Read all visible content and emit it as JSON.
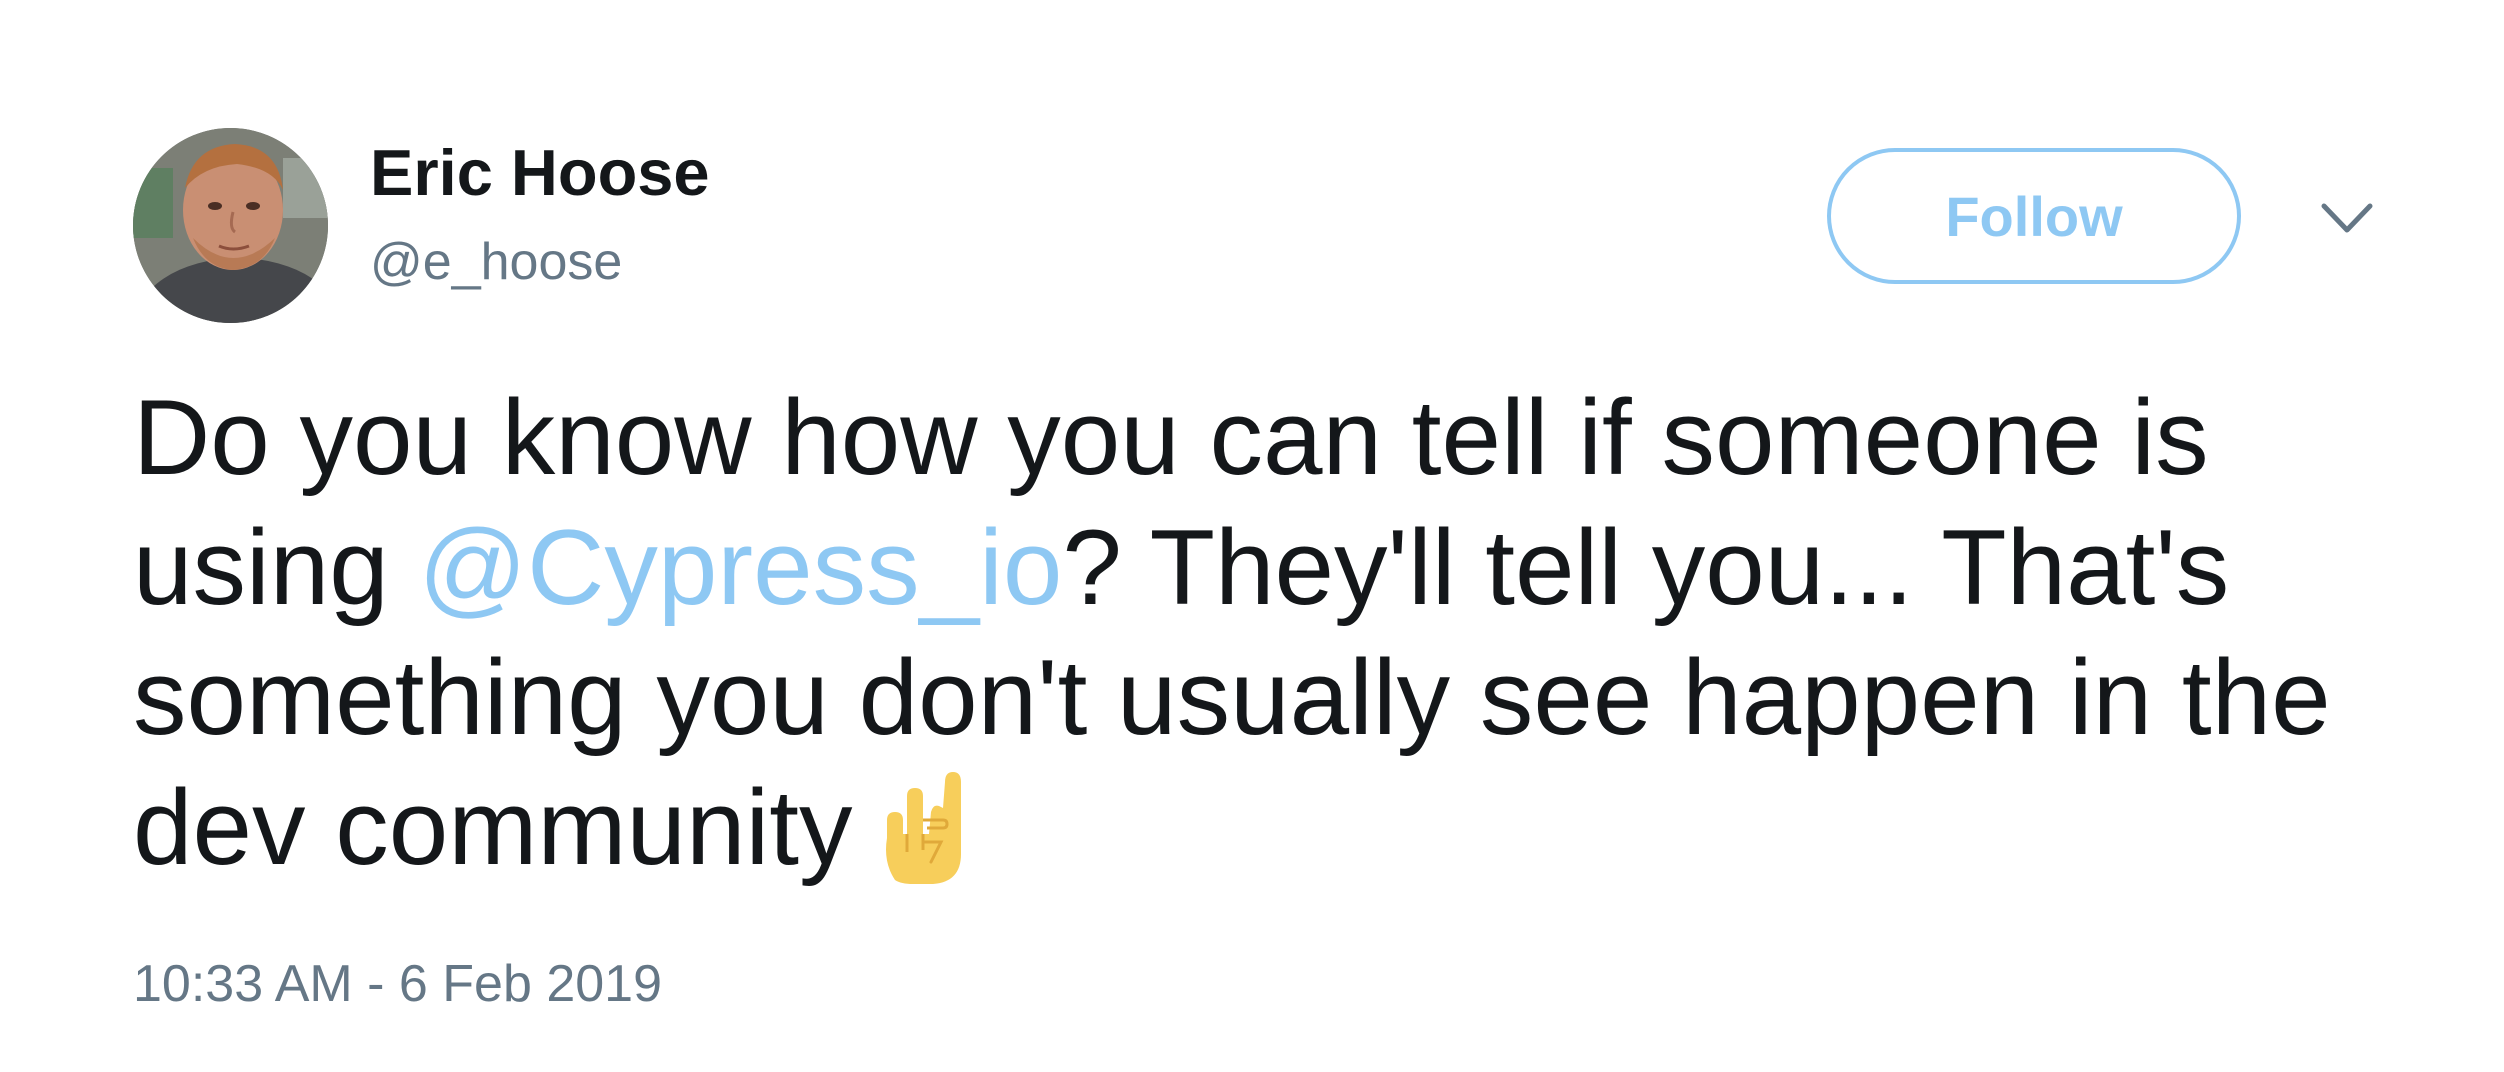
{
  "user": {
    "display_name": "Eric Hoose",
    "handle": "@e_hoose"
  },
  "follow_button": {
    "label": "Follow"
  },
  "menu_caret": {
    "icon": "chevron-down-icon"
  },
  "tweet": {
    "text_before_mention": "Do you know how you can tell if someone is using ",
    "mention": "@Cypress_io",
    "text_after_mention": "? They'll tell you... That's something you don't usually see happen in the dev community",
    "emoji": "🤘",
    "timestamp": "10:33 AM - 6 Feb 2019"
  },
  "colors": {
    "accent": "#8ec8f3",
    "text": "#14171a",
    "muted": "#657786"
  }
}
